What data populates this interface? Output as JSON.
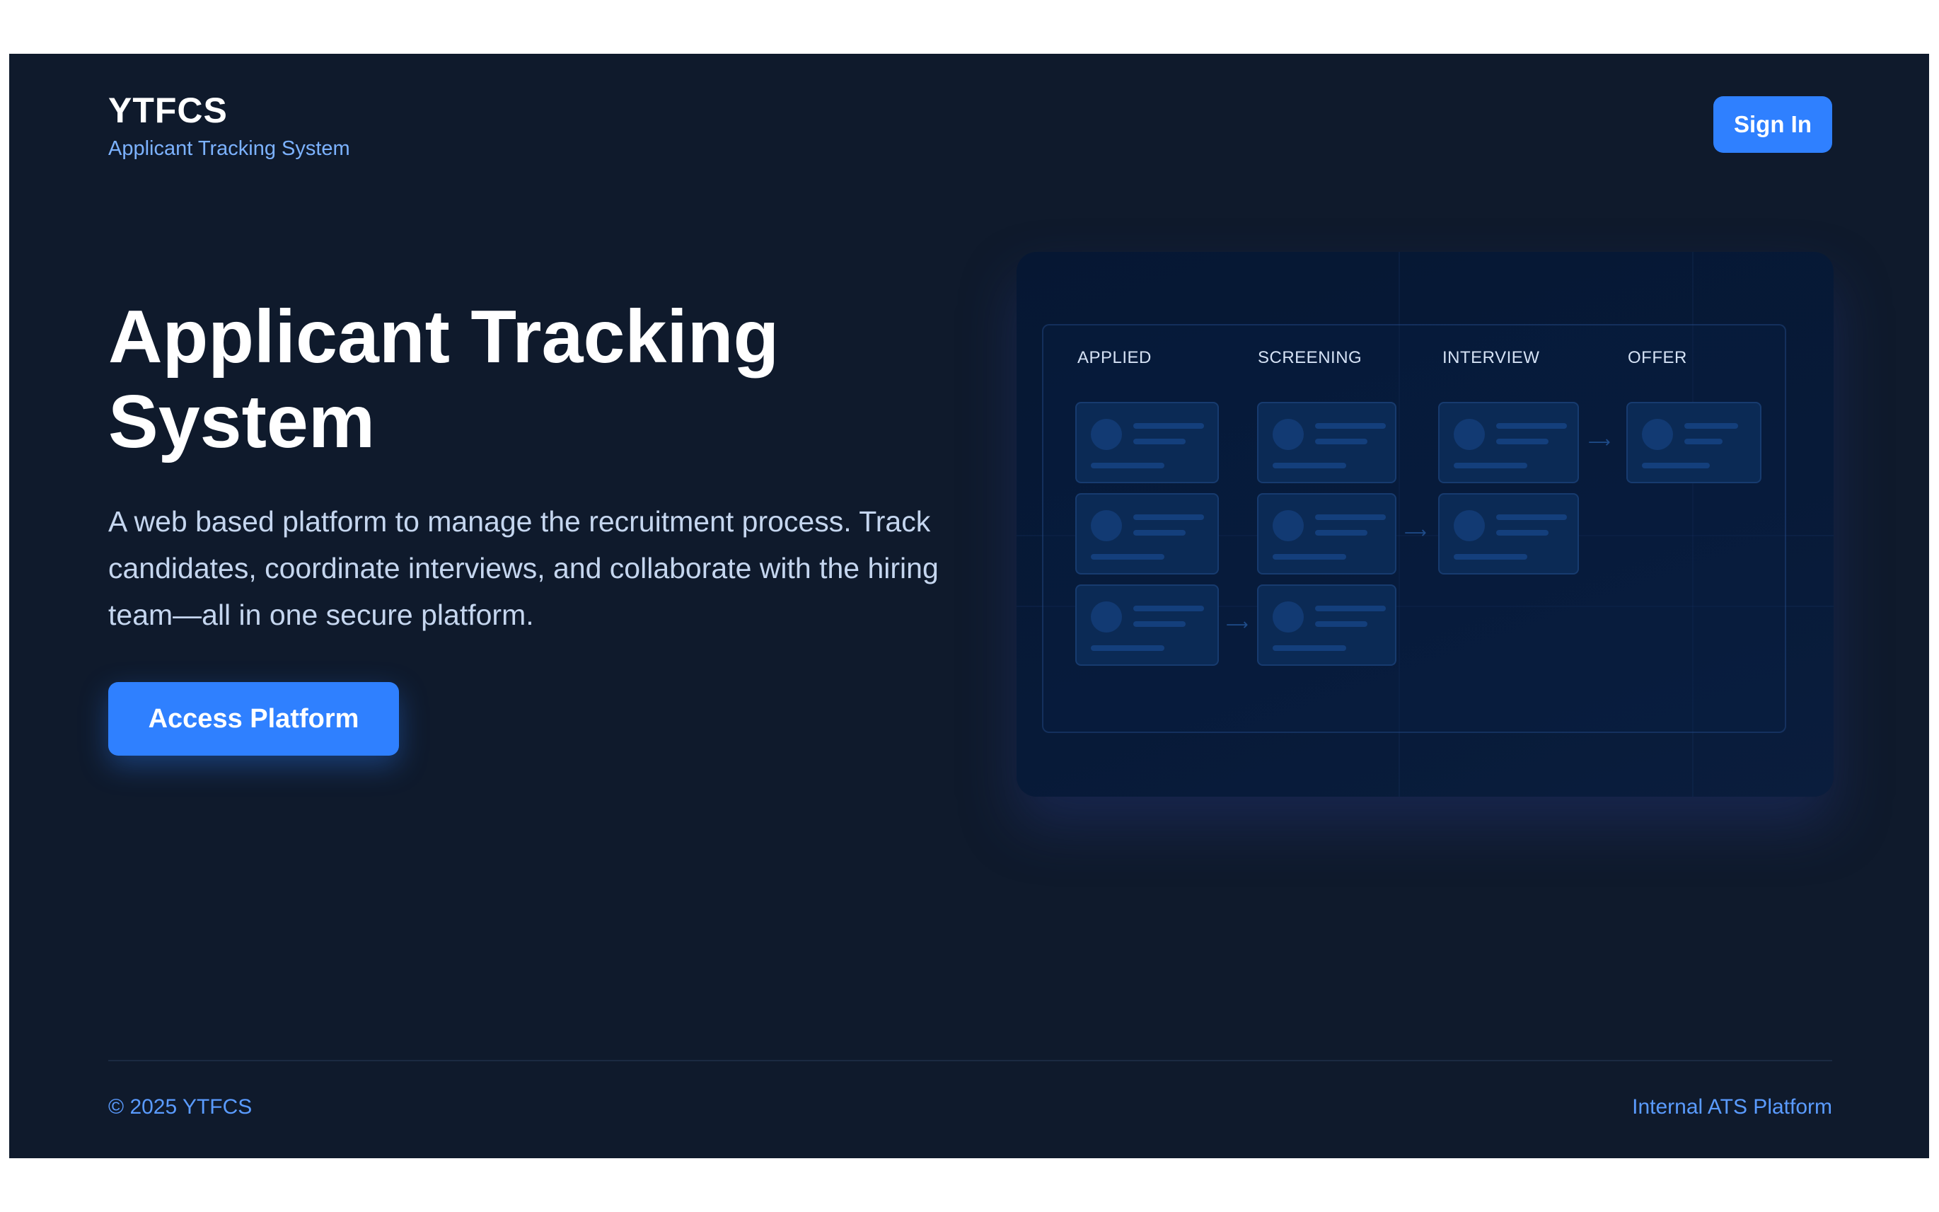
{
  "brand": {
    "name": "YTFCS",
    "subtitle": "Applicant Tracking System"
  },
  "header": {
    "signin_label": "Sign In"
  },
  "hero": {
    "title": "Applicant Tracking System",
    "description": "A web based platform to manage the recruitment process. Track candidates, coordinate interviews, and collaborate with the hiring team—all in one secure platform.",
    "cta_label": "Access Platform"
  },
  "pipeline": {
    "columns": [
      {
        "label": "APPLIED",
        "cards": 3
      },
      {
        "label": "SCREENING",
        "cards": 3
      },
      {
        "label": "INTERVIEW",
        "cards": 2
      },
      {
        "label": "OFFER",
        "cards": 1
      }
    ]
  },
  "footer": {
    "copyright": "© 2025 YTFCS",
    "tagline": "Internal ATS Platform"
  },
  "colors": {
    "background": "#0f1a2c",
    "accent": "#2f80ff",
    "subtitle": "#7cb2ff",
    "footer_text": "#5a9bff"
  }
}
